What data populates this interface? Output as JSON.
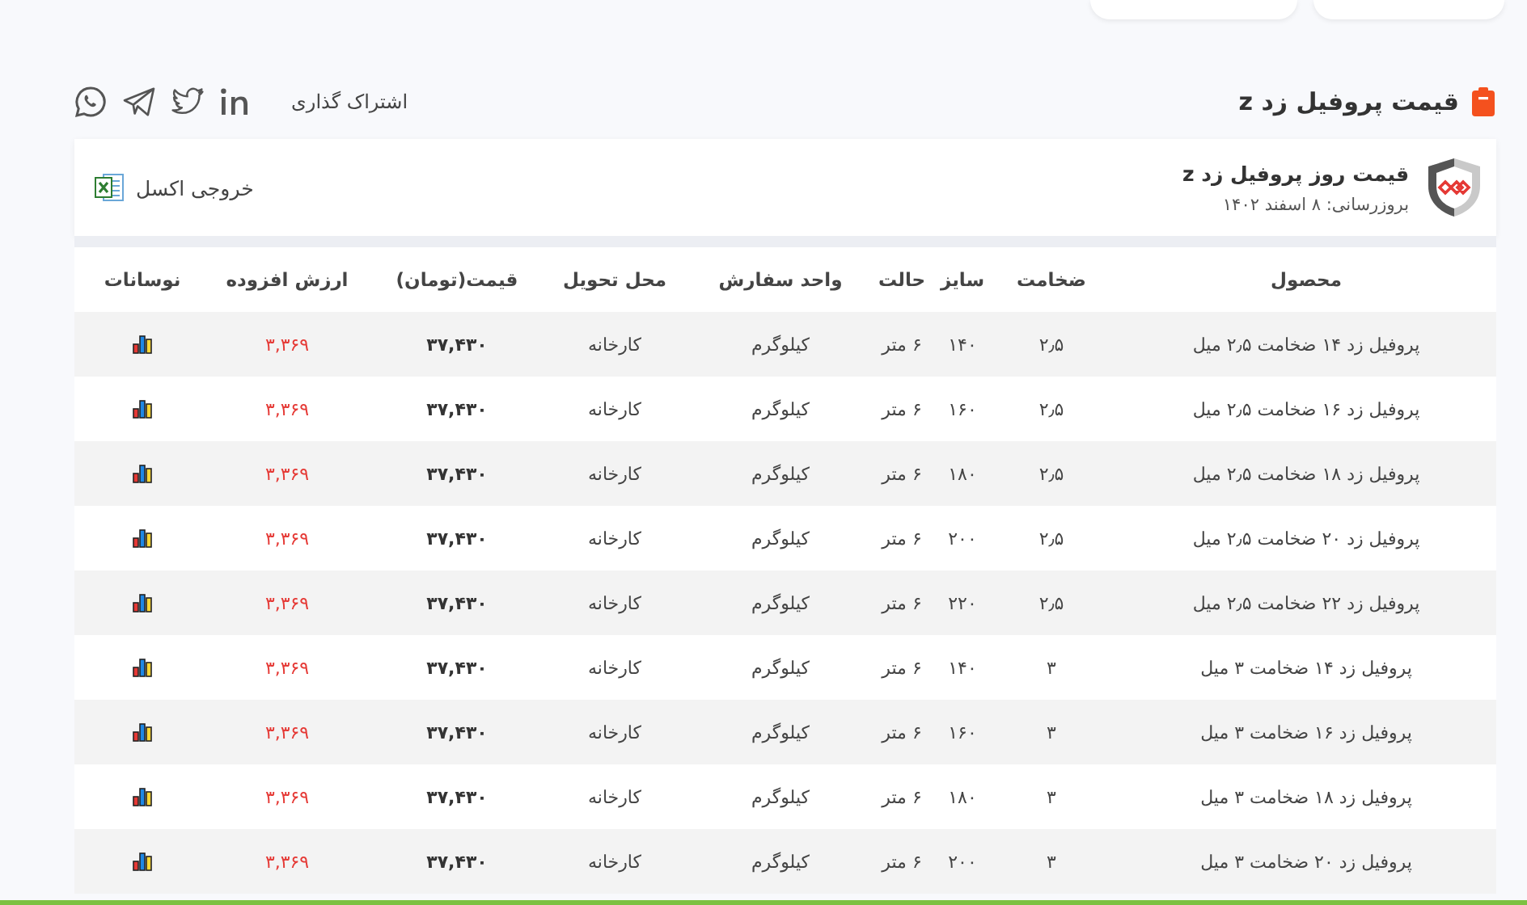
{
  "page_title": "قیمت پروفیل زد z",
  "share": {
    "label": "اشتراک گذاری",
    "icons": [
      {
        "kind": "linkedin"
      },
      {
        "kind": "twitter"
      },
      {
        "kind": "telegram"
      },
      {
        "kind": "whatsapp"
      }
    ]
  },
  "panel": {
    "title": "قیمت روز پروفیل زد z",
    "updated": "بروزرسانی: ۸ اسفند ۱۴۰۲",
    "export": "خروجی اکسل"
  },
  "table": {
    "columns": [
      "محصول",
      "ضخامت",
      "سایز",
      "حالت",
      "واحد سفارش",
      "محل تحویل",
      "قیمت(تومان)",
      "ارزش افزوده",
      "نوسانات"
    ],
    "rows": [
      [
        "پروفیل زد ۱۴ ضخامت ۲٫۵ میل",
        "۲٫۵",
        "۱۴۰",
        "۶ متر",
        "کیلوگرم",
        "کارخانه",
        "۳۷,۴۳۰",
        "۳,۳۶۹"
      ],
      [
        "پروفیل زد ۱۶ ضخامت ۲٫۵ میل",
        "۲٫۵",
        "۱۶۰",
        "۶ متر",
        "کیلوگرم",
        "کارخانه",
        "۳۷,۴۳۰",
        "۳,۳۶۹"
      ],
      [
        "پروفیل زد ۱۸ ضخامت ۲٫۵ میل",
        "۲٫۵",
        "۱۸۰",
        "۶ متر",
        "کیلوگرم",
        "کارخانه",
        "۳۷,۴۳۰",
        "۳,۳۶۹"
      ],
      [
        "پروفیل زد ۲۰ ضخامت ۲٫۵ میل",
        "۲٫۵",
        "۲۰۰",
        "۶ متر",
        "کیلوگرم",
        "کارخانه",
        "۳۷,۴۳۰",
        "۳,۳۶۹"
      ],
      [
        "پروفیل زد ۲۲ ضخامت ۲٫۵ میل",
        "۲٫۵",
        "۲۲۰",
        "۶ متر",
        "کیلوگرم",
        "کارخانه",
        "۳۷,۴۳۰",
        "۳,۳۶۹"
      ],
      [
        "پروفیل زد ۱۴ ضخامت ۳ میل",
        "۳",
        "۱۴۰",
        "۶ متر",
        "کیلوگرم",
        "کارخانه",
        "۳۷,۴۳۰",
        "۳,۳۶۹"
      ],
      [
        "پروفیل زد ۱۶ ضخامت ۳ میل",
        "۳",
        "۱۶۰",
        "۶ متر",
        "کیلوگرم",
        "کارخانه",
        "۳۷,۴۳۰",
        "۳,۳۶۹"
      ],
      [
        "پروفیل زد ۱۸ ضخامت ۳ میل",
        "۳",
        "۱۸۰",
        "۶ متر",
        "کیلوگرم",
        "کارخانه",
        "۳۷,۴۳۰",
        "۳,۳۶۹"
      ],
      [
        "پروفیل زد ۲۰ ضخامت ۳ میل",
        "۳",
        "۲۰۰",
        "۶ متر",
        "کیلوگرم",
        "کارخانه",
        "۳۷,۴۳۰",
        "۳,۳۶۹"
      ]
    ]
  }
}
